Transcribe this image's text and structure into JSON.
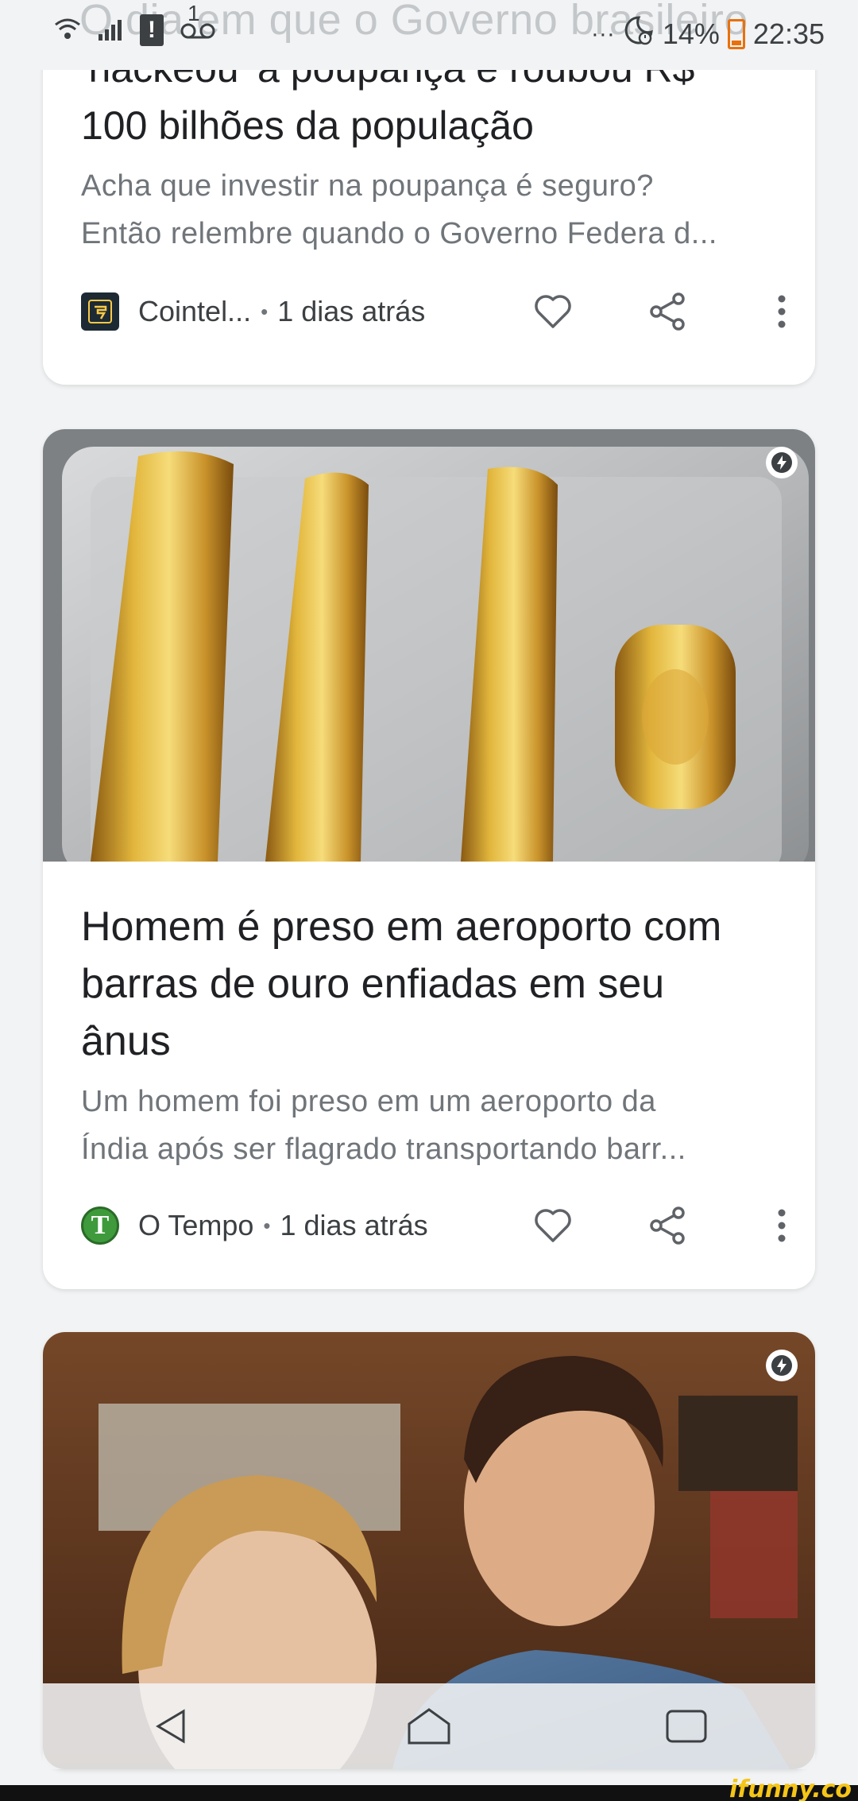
{
  "status_bar": {
    "overlay_text": "O dia em que o Governo brasileiro",
    "notification_count": "1",
    "alert_glyph": "!",
    "battery": "14%",
    "time": "22:35",
    "icons": [
      "wifi-icon",
      "signal-icon",
      "alert-icon",
      "voicemail-icon",
      "dots-icon",
      "alarm-icon",
      "battery-icon"
    ]
  },
  "cards": [
    {
      "headline_line1": "'hackeou' a poupança e roubou R$",
      "headline_line2": "100 bilhões da população",
      "snippet_line1": "Acha que investir na poupança é seguro?",
      "snippet_line2": "Então relembre quando o Governo Federa d...",
      "source": "Cointel...",
      "separator": "•",
      "time": "1 dias atrás"
    },
    {
      "headline_line1": "Homem é preso em aeroporto com",
      "headline_line2": "barras de ouro enfiadas em seu",
      "headline_line3": "ânus",
      "snippet_line1": "Um homem foi preso em um aeroporto da",
      "snippet_line2": "Índia após ser flagrado transportando barr...",
      "source": "O Tempo",
      "separator": "•",
      "time": "1 dias atrás",
      "source_logo_letter": "T"
    },
    {}
  ],
  "watermark": "ifunny.co",
  "colors": {
    "background": "#f1f3f4",
    "card": "#ffffff",
    "headline": "#202124",
    "snippet": "#70757a",
    "icon": "#5f6368",
    "otempo_green": "#3f9a3c",
    "watermark": "#f5c518"
  }
}
